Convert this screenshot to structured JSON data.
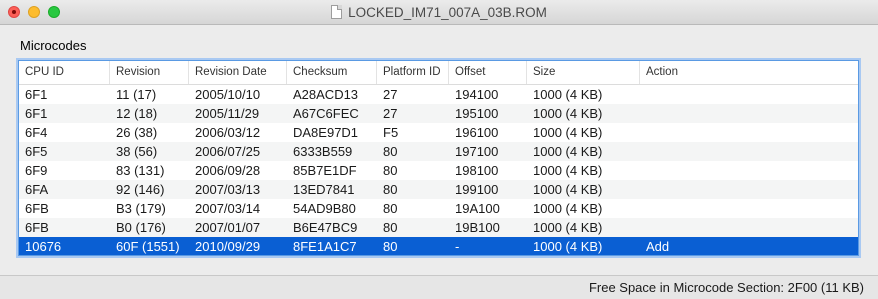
{
  "window": {
    "title": "LOCKED_IM71_007A_03B.ROM"
  },
  "section": {
    "label": "Microcodes"
  },
  "table": {
    "columns": [
      "CPU ID",
      "Revision",
      "Revision Date",
      "Checksum",
      "Platform ID",
      "Offset",
      "Size",
      "Action"
    ],
    "rows": [
      [
        "6F1",
        "11 (17)",
        "2005/10/10",
        "A28ACD13",
        "27",
        "194100",
        "1000 (4 KB)",
        ""
      ],
      [
        "6F1",
        "12 (18)",
        "2005/11/29",
        "A67C6FEC",
        "27",
        "195100",
        "1000 (4 KB)",
        ""
      ],
      [
        "6F4",
        "26 (38)",
        "2006/03/12",
        "DA8E97D1",
        "F5",
        "196100",
        "1000 (4 KB)",
        ""
      ],
      [
        "6F5",
        "38 (56)",
        "2006/07/25",
        "6333B559",
        "80",
        "197100",
        "1000 (4 KB)",
        ""
      ],
      [
        "6F9",
        "83 (131)",
        "2006/09/28",
        "85B7E1DF",
        "80",
        "198100",
        "1000 (4 KB)",
        ""
      ],
      [
        "6FA",
        "92 (146)",
        "2007/03/13",
        "13ED7841",
        "80",
        "199100",
        "1000 (4 KB)",
        ""
      ],
      [
        "6FB",
        "B3 (179)",
        "2007/03/14",
        "54AD9B80",
        "80",
        "19A100",
        "1000 (4 KB)",
        ""
      ],
      [
        "6FB",
        "B0 (176)",
        "2007/01/07",
        "B6E47BC9",
        "80",
        "19B100",
        "1000 (4 KB)",
        ""
      ],
      [
        "10676",
        "60F (1551)",
        "2010/09/29",
        "8FE1A1C7",
        "80",
        "-",
        "1000 (4 KB)",
        "Add"
      ]
    ],
    "selected_row": 8
  },
  "status": {
    "text": "Free Space in Microcode Section: 2F00 (11 KB)"
  },
  "colors": {
    "selection": "#0a5fd3",
    "focus_ring": "#5a9ae3"
  }
}
